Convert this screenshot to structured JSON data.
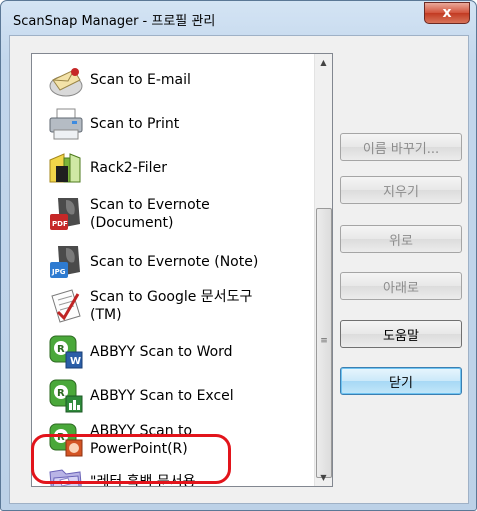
{
  "window": {
    "title": "ScanSnap Manager - 프로필 관리",
    "close_label": "x"
  },
  "profiles": [
    {
      "label": "Scan to E-mail",
      "icon": "email-profile-icon"
    },
    {
      "label": "Scan to Print",
      "icon": "printer-profile-icon"
    },
    {
      "label": "Rack2-Filer",
      "icon": "rack2-filer-icon"
    },
    {
      "label": "Scan to Evernote\n(Document)",
      "icon": "evernote-pdf-icon"
    },
    {
      "label": "Scan to Evernote (Note)",
      "icon": "evernote-jpg-icon"
    },
    {
      "label": "Scan to Google 문서도구\n(TM)",
      "icon": "google-docs-icon"
    },
    {
      "label": "ABBYY Scan to Word",
      "icon": "abbyy-word-icon"
    },
    {
      "label": "ABBYY Scan to Excel",
      "icon": "abbyy-excel-icon"
    },
    {
      "label": "ABBYY Scan to\nPowerPoint(R)",
      "icon": "abbyy-powerpoint-icon"
    },
    {
      "label": "\"레터 흑백 문서용",
      "icon": "folder-profile-icon"
    }
  ],
  "buttons": {
    "rename": "이름 바꾸기...",
    "delete": "지우기",
    "up": "위로",
    "down": "아래로",
    "help": "도움말",
    "close": "닫기"
  },
  "colors": {
    "highlight": "#e2141b",
    "default_button": "#a7d8f5"
  }
}
